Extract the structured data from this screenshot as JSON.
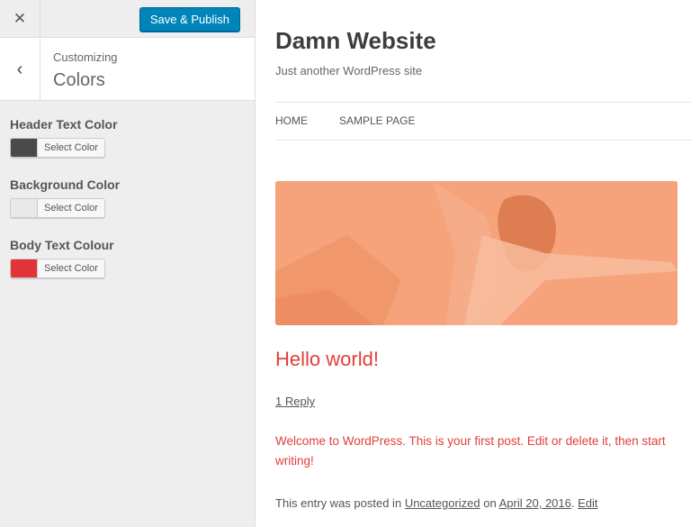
{
  "toolbar": {
    "close_icon": "close-icon",
    "publish_label": "Save & Publish",
    "publish_color": "#0085ba"
  },
  "section": {
    "breadcrumb": "Customizing",
    "title": "Colors",
    "back_icon": "chevron-left-icon"
  },
  "controls": [
    {
      "label": "Header Text Color",
      "button": "Select Color",
      "color": "#4a4a4a"
    },
    {
      "label": "Background Color",
      "button": "Select Color",
      "color": "#e9e9e9"
    },
    {
      "label": "Body Text Colour",
      "button": "Select Color",
      "color": "#e0343a"
    }
  ],
  "preview": {
    "site_title": "Damn Website",
    "site_description": "Just another WordPress site",
    "nav": [
      "HOME",
      "SAMPLE PAGE"
    ],
    "post": {
      "title": "Hello world!",
      "replies": "1 Reply",
      "body": "Welcome to WordPress. This is your first post. Edit or delete it, then start writing!",
      "meta_prefix": "This entry was posted in",
      "category": "Uncategorized",
      "meta_on": "on",
      "date": "April 20, 2016",
      "edit": "Edit"
    }
  }
}
